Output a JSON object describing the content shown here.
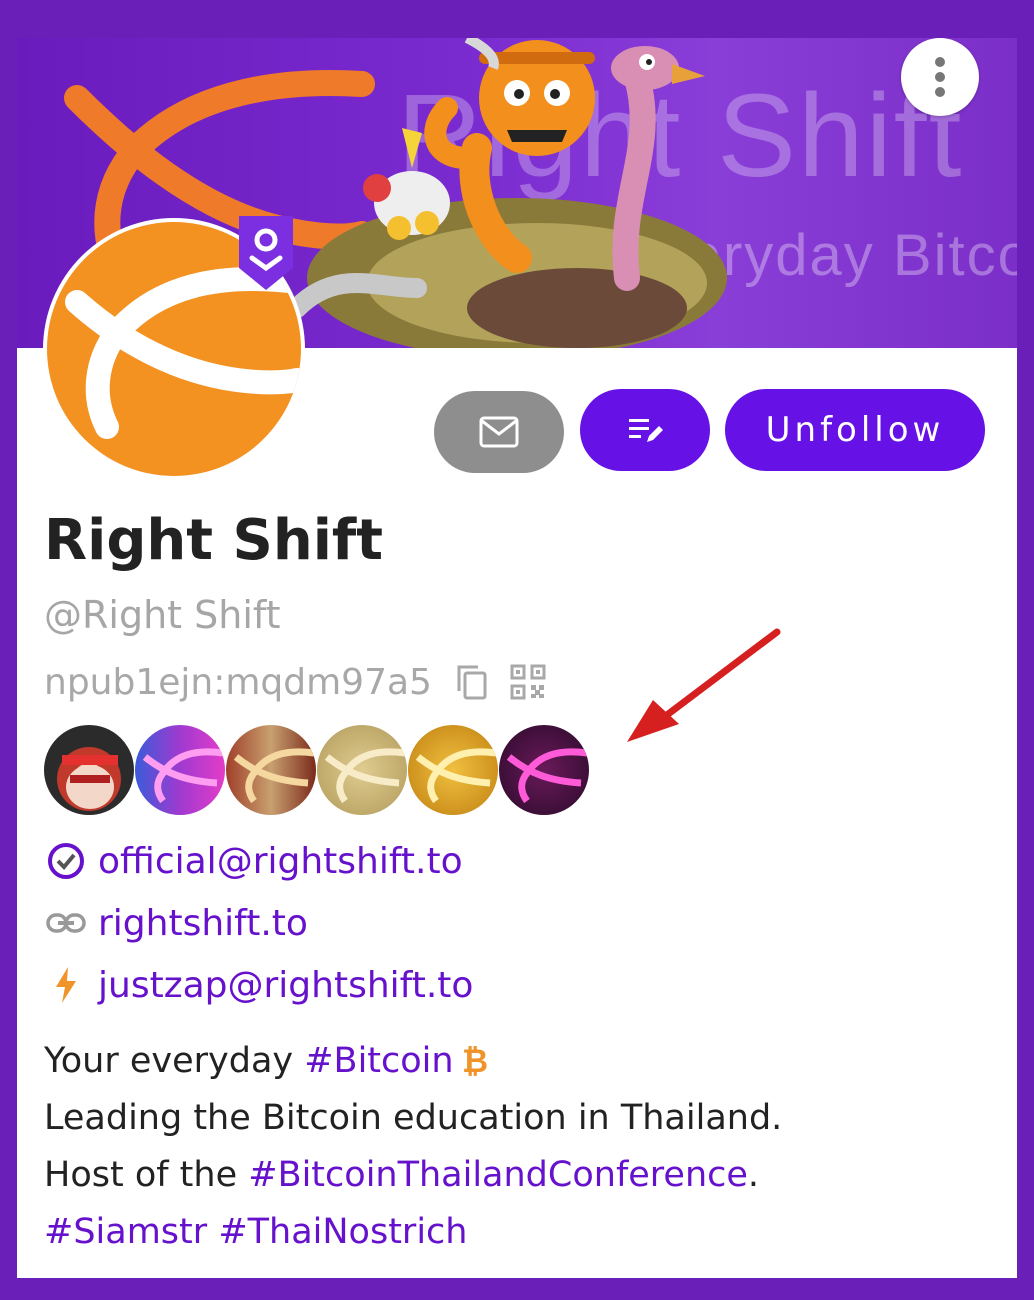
{
  "banner": {
    "title": "Right Shift",
    "subtitle": "Everyday Bitcoin"
  },
  "actions": {
    "unfollow_label": "Unfollow"
  },
  "profile": {
    "display_name": "Right Shift",
    "handle": "@Right Shift",
    "npub": "npub1ejn:mqdm97a5"
  },
  "links": {
    "nip05": "official@rightshift.to",
    "website": "rightshift.to",
    "lightning": "justzap@rightshift.to"
  },
  "bio": {
    "line1_text": "Your everyday ",
    "line1_tag": "#Bitcoin",
    "line2": "Leading the Bitcoin education in Thailand.",
    "line3_text": "Host of the ",
    "line3_tag": "#BitcoinThailandConference",
    "line3_end": ".",
    "tag_siamstr": "#Siamstr",
    "tag_thainostrich": "#ThaiNostrich"
  },
  "colors": {
    "accent": "#6611e6",
    "frame": "#6a1fb8",
    "brand_orange": "#f39121",
    "link": "#6611cc",
    "annotation_arrow": "#d61f1f"
  },
  "icons": [
    "more-vertical-icon",
    "mail-icon",
    "edit-list-icon",
    "copy-icon",
    "qr-code-icon",
    "verified-check-icon",
    "link-icon",
    "lightning-icon",
    "bitcoin-icon",
    "verified-shield-badge-icon"
  ]
}
